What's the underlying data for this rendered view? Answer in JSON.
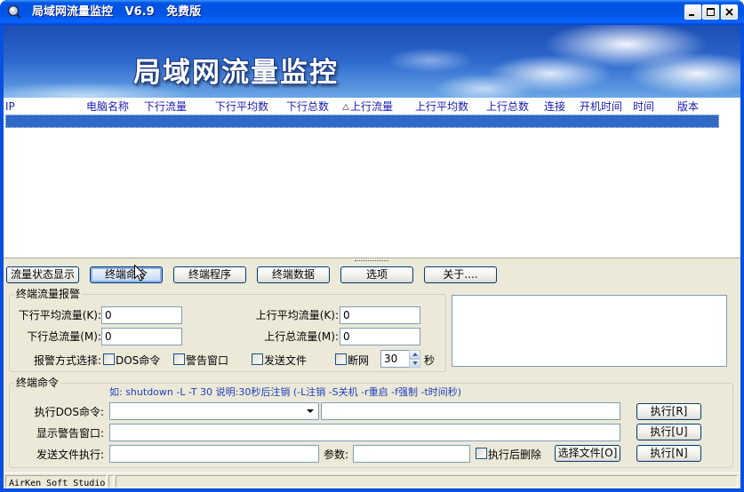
{
  "window": {
    "title": "局域网流量监控 V6.9 免费版",
    "icon": "network-monitor-icon",
    "controls": {
      "minimize": "minimize-icon",
      "maximize": "maximize-icon",
      "close": "close-icon"
    }
  },
  "banner": {
    "title": "局域网流量监控"
  },
  "table": {
    "columns": [
      "IP",
      "电脑名称",
      "下行流量",
      "下行平均数",
      "下行总数",
      "上行流量",
      "上行平均数",
      "上行总数",
      "连接",
      "开机时间",
      "时间",
      "版本"
    ],
    "sort": {
      "column_index": 5,
      "icon": "sort-triangle-icon"
    },
    "rows": [
      {
        "selected": true,
        "cells": [
          "",
          "",
          "",
          "",
          "",
          "",
          "",
          "",
          "",
          "",
          "",
          ""
        ]
      }
    ]
  },
  "tabs": [
    {
      "label": "流量状态显示",
      "active": false
    },
    {
      "label": "终端命令",
      "active": true
    },
    {
      "label": "终端程序",
      "active": false
    },
    {
      "label": "终端数据",
      "active": false
    },
    {
      "label": "选项",
      "active": false
    },
    {
      "label": "关于....",
      "active": false
    }
  ],
  "alarm": {
    "title": "终端流量报警",
    "down_avg": {
      "label": "下行平均流量(K):",
      "value": "0"
    },
    "up_avg": {
      "label": "上行平均流量(K):",
      "value": "0"
    },
    "down_total": {
      "label": "下行总流量(M):",
      "value": "0"
    },
    "up_total": {
      "label": "上行总流量(M):",
      "value": "0"
    },
    "method_label": "报警方式选择:",
    "methods": [
      {
        "label": "DOS命令",
        "checked": false
      },
      {
        "label": "警告窗口",
        "checked": false
      },
      {
        "label": "发送文件",
        "checked": false
      },
      {
        "label": "断网",
        "checked": false
      }
    ],
    "interval": {
      "value": "30",
      "unit": "秒"
    },
    "log": ""
  },
  "command": {
    "title": "终端命令",
    "hint": "如: shutdown -L -T 30 说明:30秒后注销 (-L注销 -S关机 -r重启 -f强制 -t时间秒)",
    "dos": {
      "label": "执行DOS命令:",
      "value": "",
      "args": "",
      "button": "执行[R]"
    },
    "warn": {
      "label": "显示警告窗口:",
      "value": "",
      "button": "执行[U]"
    },
    "file": {
      "label": "发送文件执行:",
      "value": "",
      "params_label": "参数:",
      "params_value": "",
      "delete_after": {
        "label": "执行后删除",
        "checked": false
      },
      "choose_button": "选择文件[O]",
      "button": "执行[N]"
    }
  },
  "statusbar": {
    "text": "AirKen Soft Studio"
  },
  "overlay": {
    "pointer_icon": "mouse-pointer-icon"
  },
  "colors": {
    "title_bar": "#0054e3",
    "window_frame": "#0a50e0",
    "client_background": "#ece9d8",
    "selection": "#316ac5",
    "header_text": "#1b1bb4",
    "hint_text": "#1f3fbf",
    "button_border": "#003c74",
    "input_border": "#7f9db9"
  }
}
